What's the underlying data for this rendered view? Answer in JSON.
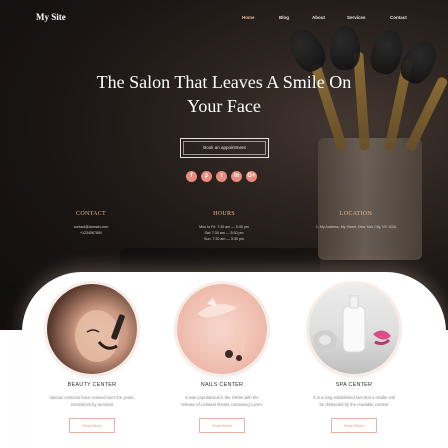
{
  "nav": {
    "logo": "My Site",
    "items": [
      {
        "label": "Home",
        "active": true
      },
      {
        "label": "Blog",
        "active": false
      },
      {
        "label": "About",
        "active": false
      },
      {
        "label": "Services",
        "active": false
      },
      {
        "label": "Contact",
        "active": false
      }
    ]
  },
  "hero": {
    "headline_line1": "The Salon That Leaves A Smile On",
    "headline_line2": "Your Face",
    "cta_label": "Book an appointment"
  },
  "socials": [
    {
      "icon": "facebook-icon",
      "glyph": "f"
    },
    {
      "icon": "pinterest-icon",
      "glyph": "p"
    },
    {
      "icon": "twitter-icon",
      "glyph": "t"
    },
    {
      "icon": "linkedin-icon",
      "glyph": "in"
    },
    {
      "icon": "google-plus-icon",
      "glyph": "G+"
    }
  ],
  "info": {
    "contact": {
      "title": "CONTACT",
      "lines": [
        "contact@domain.com",
        "+1234567890"
      ]
    },
    "hours": {
      "title": "HOURS",
      "lines": [
        "Mon to Fri: 7:30 am — 5:30 pm",
        "Sat: 7:30 am — 5:30 pm",
        "Sun: 7:30 am — 5:30 pm"
      ]
    },
    "location": {
      "title": "LOCATION",
      "lines": [
        "1, My Address, My Street, New York City, NY, USA"
      ]
    }
  },
  "services": [
    {
      "title": "BEAUTY CENTER",
      "text_line1": "Various versions have evolved over the years,",
      "text_line2": "sometimes by accident",
      "button": "Read More"
    },
    {
      "title": "NAILS CENTER",
      "text_line1": "It was popularised in the 1960s with the",
      "text_line2": "release of Letraset sheets containing Lorem",
      "button": "Read More"
    },
    {
      "title": "SPA CENTER",
      "text_line1": "It is a long established fact that a reader will",
      "text_line2": "be distracted by the readable content",
      "button": "Read More"
    }
  ],
  "colors": {
    "accent": "#e98a7c",
    "nav_active": "#f0b894",
    "info_title": "#e4b896",
    "button_border": "#e6b3a3"
  }
}
